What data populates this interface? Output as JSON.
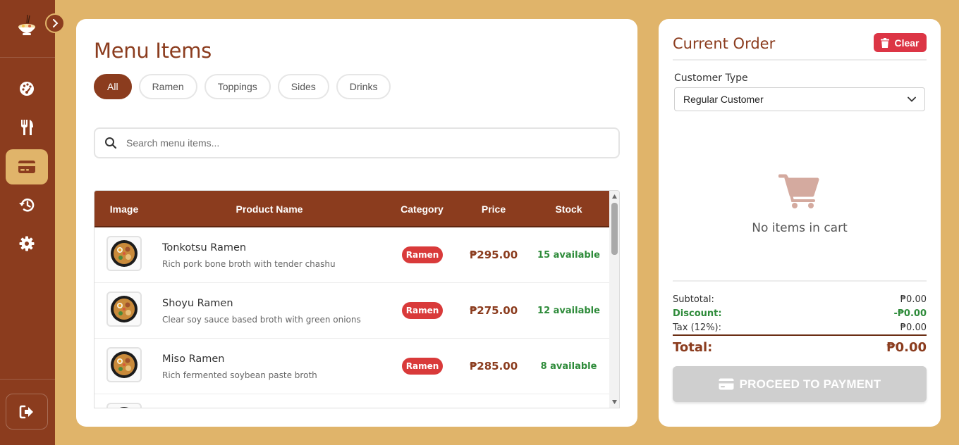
{
  "sidebar": {
    "items": [
      {
        "name": "dashboard",
        "icon": "palette-gauge-icon"
      },
      {
        "name": "menu",
        "icon": "utensils-icon"
      },
      {
        "name": "pos",
        "icon": "credit-card-icon",
        "active": true
      },
      {
        "name": "history",
        "icon": "history-icon"
      },
      {
        "name": "settings",
        "icon": "gear-icon"
      }
    ],
    "logout_icon": "sign-out-icon"
  },
  "menu": {
    "title": "Menu Items",
    "filters": [
      "All",
      "Ramen",
      "Toppings",
      "Sides",
      "Drinks"
    ],
    "active_filter": "All",
    "search": {
      "placeholder": "Search menu items..."
    },
    "columns": {
      "image": "Image",
      "name": "Product Name",
      "category": "Category",
      "price": "Price",
      "stock": "Stock"
    },
    "rows": [
      {
        "name": "Tonkotsu Ramen",
        "desc": "Rich pork bone broth with tender chashu",
        "category": "Ramen",
        "price": "₱295.00",
        "stock": "15 available"
      },
      {
        "name": "Shoyu Ramen",
        "desc": "Clear soy sauce based broth with green onions",
        "category": "Ramen",
        "price": "₱275.00",
        "stock": "12 available"
      },
      {
        "name": "Miso Ramen",
        "desc": "Rich fermented soybean paste broth",
        "category": "Ramen",
        "price": "₱285.00",
        "stock": "8 available"
      }
    ]
  },
  "order": {
    "title": "Current Order",
    "clear_label": "Clear",
    "customer_type_label": "Customer Type",
    "customer_type_value": "Regular Customer",
    "empty_text": "No items in cart",
    "subtotal_label": "Subtotal:",
    "subtotal_value": "₱0.00",
    "discount_label": "Discount:",
    "discount_value": "-₱0.00",
    "tax_label": "Tax (12%):",
    "tax_value": "₱0.00",
    "total_label": "Total:",
    "total_value": "₱0.00",
    "pay_label": "PROCEED TO PAYMENT"
  },
  "colors": {
    "brand": "#8b3c1e",
    "background": "#e0b46a",
    "danger": "#dc3545",
    "success": "#2e8b3a"
  }
}
